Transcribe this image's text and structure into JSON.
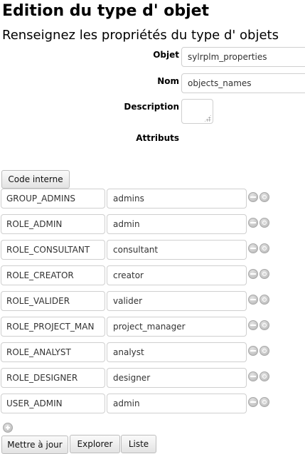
{
  "page": {
    "title": "Edition du type d' objet",
    "subtitle": "Renseignez les propriétés du type d' objets"
  },
  "form": {
    "objet_label": "Objet",
    "objet_value": "sylrplm_properties",
    "nom_label": "Nom",
    "nom_value": "objects_names",
    "description_label": "Description",
    "description_value": "",
    "attributs_label": "Attributs"
  },
  "attributes": {
    "code_button_label": "Code interne",
    "rows": [
      {
        "key": "GROUP_ADMINS",
        "value": "admins"
      },
      {
        "key": "ROLE_ADMIN",
        "value": "admin"
      },
      {
        "key": "ROLE_CONSULTANT",
        "value": "consultant"
      },
      {
        "key": "ROLE_CREATOR",
        "value": "creator"
      },
      {
        "key": "ROLE_VALIDER",
        "value": "valider"
      },
      {
        "key": "ROLE_PROJECT_MAN",
        "value": "project_manager"
      },
      {
        "key": "ROLE_ANALYST",
        "value": "analyst"
      },
      {
        "key": "ROLE_DESIGNER",
        "value": "designer"
      },
      {
        "key": "USER_ADMIN",
        "value": "admin"
      }
    ]
  },
  "actions": {
    "update_label": "Mettre à jour",
    "explore_label": "Explorer",
    "list_label": "Liste"
  },
  "icons": {
    "remove": "minus-circle-icon",
    "action": "circle-icon",
    "add": "plus-circle-icon"
  }
}
